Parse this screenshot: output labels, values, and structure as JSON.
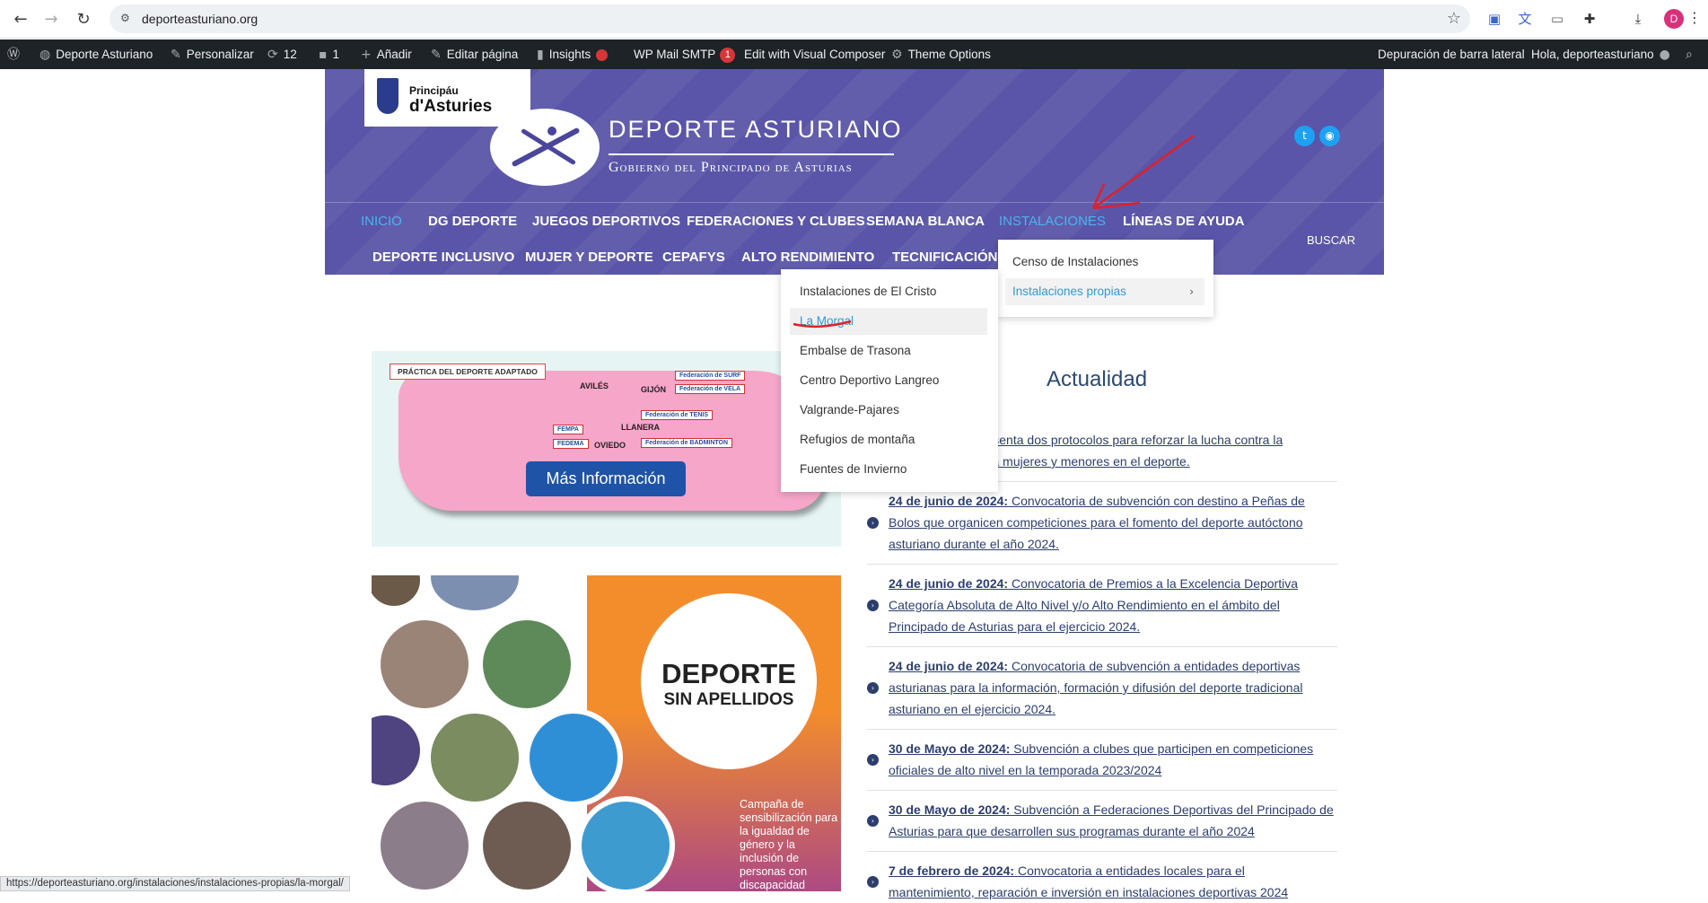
{
  "browser": {
    "url": "deporteasturiano.org",
    "profile_initial": "D",
    "status_url": "https://deporteasturiano.org/instalaciones/instalaciones-propias/la-morgal/"
  },
  "adminbar": {
    "site_name": "Deporte Asturiano",
    "customize": "Personalizar",
    "updates_count": "12",
    "comments_count": "1",
    "add_new": "Añadir",
    "edit_page": "Editar página",
    "insights": "Insights",
    "wp_mail_smtp": "WP Mail SMTP",
    "wp_mail_badge": "1",
    "visual_composer": "Edit with Visual Composer",
    "theme_options": "Theme Options",
    "sidebar_debug": "Depuración de barra lateral",
    "greeting": "Hola, deporteasturiano"
  },
  "header": {
    "gov_line1": "Principáu",
    "gov_line2": "d'Asturies",
    "title": "DEPORTE ASTURIANO",
    "subtitle": "Gobierno del Principado de Asturias",
    "twitter_color": "#1da1f2",
    "rss_color": "#1da1f2",
    "accent": "#5a55a8"
  },
  "nav": {
    "row1": [
      "INICIO",
      "DG DEPORTE",
      "JUEGOS DEPORTIVOS",
      "FEDERACIONES Y CLUBES",
      "SEMANA BLANCA",
      "INSTALACIONES",
      "LÍNEAS DE AYUDA"
    ],
    "row2": [
      "DEPORTE INCLUSIVO",
      "MUJER Y DEPORTE",
      "CEPAFYS",
      "ALTO RENDIMIENTO",
      "TECNIFICACIÓN D"
    ],
    "search": "BUSCAR"
  },
  "dropdown_instalaciones": {
    "items": [
      "Censo de Instalaciones",
      "Instalaciones propias"
    ]
  },
  "dropdown_propias": {
    "items": [
      "Instalaciones de El Cristo",
      "La Morgal",
      "Embalse de Trasona",
      "Centro Deportivo Langreo",
      "Valgrande-Pajares",
      "Refugios de montaña",
      "Fuentes de Invierno"
    ]
  },
  "promo_adaptado": {
    "tag": "PRÁCTICA DEL DEPORTE ADAPTADO",
    "cities": [
      "AVILÉS",
      "GIJÓN",
      "LLANERA",
      "OVIEDO"
    ],
    "federations": [
      "Federación de SURF",
      "Federación de VELA",
      "Federación de TENIS",
      "FEMPA",
      "FEDEMA",
      "Federación de BADMINTON"
    ],
    "button": "Más Información"
  },
  "promo_campaign": {
    "title1": "DEPORTE",
    "title2": "SIN APELLIDOS",
    "text": "Campaña de sensibilización para la igualdad de género y la inclusión de personas con discapacidad"
  },
  "news": {
    "heading": "Actualidad",
    "items": [
      {
        "date": "",
        "text": "Principado presenta dos protocolos para reforzar la lucha contra la violencia contra mujeres y menores en el deporte."
      },
      {
        "date": "24 de junio de 2024:",
        "text": " Convocatoria de subvención con destino a Peñas de Bolos que organicen competiciones para el fomento del deporte autóctono asturiano durante el año 2024."
      },
      {
        "date": "24 de junio de 2024:",
        "text": " Convocatoria de Premios a la Excelencia Deportiva Categoría Absoluta de Alto Nivel y/o Alto Rendimiento en el ámbito del Principado de Asturias para el ejercicio 2024."
      },
      {
        "date": "24 de junio de 2024:",
        "text": " Convocatoria de subvención a entidades deportivas asturianas para la información, formación y difusión del deporte tradicional asturiano en el ejercicio 2024."
      },
      {
        "date": "30 de Mayo de 2024:",
        "text": " Subvención a clubes que participen en competiciones oficiales de alto nivel en la temporada 2023/2024"
      },
      {
        "date": "30 de Mayo de 2024:",
        "text": " Subvención a Federaciones Deportivas del Principado de Asturias para que desarrollen sus programas durante el año 2024"
      },
      {
        "date": "7 de febrero de 2024:",
        "text": " Convocatoria a entidades locales para el mantenimiento, reparación e inversión en instalaciones deportivas 2024"
      }
    ]
  },
  "colors": {
    "link": "#2c3e6e",
    "highlight": "#4ab4ee",
    "annotation": "#e0202a"
  }
}
